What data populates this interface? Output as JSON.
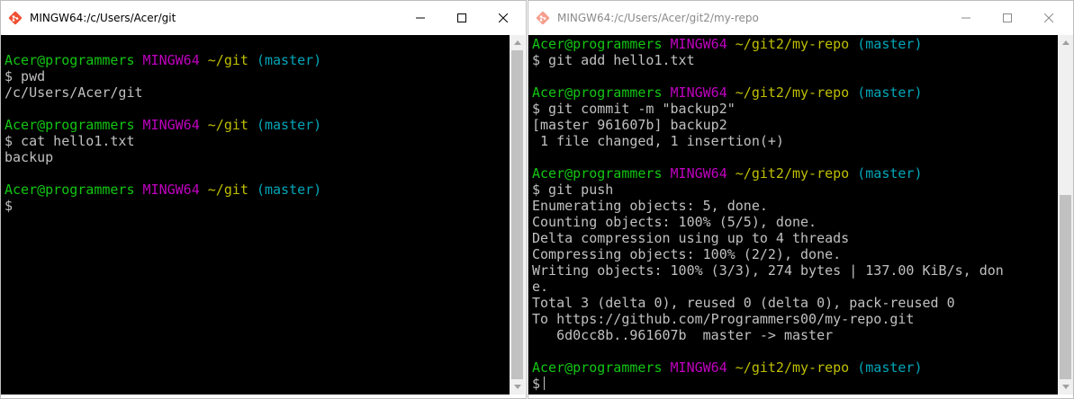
{
  "left_window": {
    "title": "MINGW64:/c/Users/Acer/git",
    "icon": "git-bash-icon",
    "buttons": {
      "minimize": "minimize-icon",
      "maximize": "maximize-icon",
      "close": "close-icon"
    },
    "lines": [
      [
        {
          "t": "Acer@programmers ",
          "c": "green"
        },
        {
          "t": "MINGW64 ",
          "c": "magenta"
        },
        {
          "t": "~/git ",
          "c": "yellow"
        },
        {
          "t": "(master)",
          "c": "cyan"
        }
      ],
      [
        {
          "t": "$ pwd",
          "c": "white"
        }
      ],
      [
        {
          "t": "/c/Users/Acer/git",
          "c": "white"
        }
      ],
      [],
      [
        {
          "t": "Acer@programmers ",
          "c": "green"
        },
        {
          "t": "MINGW64 ",
          "c": "magenta"
        },
        {
          "t": "~/git ",
          "c": "yellow"
        },
        {
          "t": "(master)",
          "c": "cyan"
        }
      ],
      [
        {
          "t": "$ cat hello1.txt",
          "c": "white"
        }
      ],
      [
        {
          "t": "backup",
          "c": "white"
        }
      ],
      [],
      [
        {
          "t": "Acer@programmers ",
          "c": "green"
        },
        {
          "t": "MINGW64 ",
          "c": "magenta"
        },
        {
          "t": "~/git ",
          "c": "yellow"
        },
        {
          "t": "(master)",
          "c": "cyan"
        }
      ],
      [
        {
          "t": "$",
          "c": "white"
        }
      ]
    ]
  },
  "right_window": {
    "title": "MINGW64:/c/Users/Acer/git2/my-repo",
    "icon": "git-bash-icon",
    "buttons": {
      "minimize": "minimize-icon",
      "maximize": "maximize-icon",
      "close": "close-icon"
    },
    "lines": [
      [
        {
          "t": "Acer@programmers ",
          "c": "green"
        },
        {
          "t": "MINGW64 ",
          "c": "magenta"
        },
        {
          "t": "~/git2/my-repo ",
          "c": "yellow"
        },
        {
          "t": "(master)",
          "c": "cyan"
        }
      ],
      [
        {
          "t": "$ git add hello1.txt",
          "c": "white"
        }
      ],
      [],
      [
        {
          "t": "Acer@programmers ",
          "c": "green"
        },
        {
          "t": "MINGW64 ",
          "c": "magenta"
        },
        {
          "t": "~/git2/my-repo ",
          "c": "yellow"
        },
        {
          "t": "(master)",
          "c": "cyan"
        }
      ],
      [
        {
          "t": "$ git commit -m \"backup2\"",
          "c": "white"
        }
      ],
      [
        {
          "t": "[master 961607b] backup2",
          "c": "white"
        }
      ],
      [
        {
          "t": " 1 file changed, 1 insertion(+)",
          "c": "white"
        }
      ],
      [],
      [
        {
          "t": "Acer@programmers ",
          "c": "green"
        },
        {
          "t": "MINGW64 ",
          "c": "magenta"
        },
        {
          "t": "~/git2/my-repo ",
          "c": "yellow"
        },
        {
          "t": "(master)",
          "c": "cyan"
        }
      ],
      [
        {
          "t": "$ git push",
          "c": "white"
        }
      ],
      [
        {
          "t": "Enumerating objects: 5, done.",
          "c": "white"
        }
      ],
      [
        {
          "t": "Counting objects: 100% (5/5), done.",
          "c": "white"
        }
      ],
      [
        {
          "t": "Delta compression using up to 4 threads",
          "c": "white"
        }
      ],
      [
        {
          "t": "Compressing objects: 100% (2/2), done.",
          "c": "white"
        }
      ],
      [
        {
          "t": "Writing objects: 100% (3/3), 274 bytes | 137.00 KiB/s, don",
          "c": "white"
        }
      ],
      [
        {
          "t": "e.",
          "c": "white"
        }
      ],
      [
        {
          "t": "Total 3 (delta 0), reused 0 (delta 0), pack-reused 0",
          "c": "white"
        }
      ],
      [
        {
          "t": "To https://github.com/Programmers00/my-repo.git",
          "c": "white"
        }
      ],
      [
        {
          "t": "   6d0cc8b..961607b  master -> master",
          "c": "white"
        }
      ],
      [],
      [
        {
          "t": "Acer@programmers ",
          "c": "green"
        },
        {
          "t": "MINGW64 ",
          "c": "magenta"
        },
        {
          "t": "~/git2/my-repo ",
          "c": "yellow"
        },
        {
          "t": "(master)",
          "c": "cyan"
        }
      ],
      [
        {
          "t": "$",
          "c": "white"
        }
      ]
    ]
  },
  "colors": {
    "green": "#13c613",
    "magenta": "#bf00bf",
    "yellow": "#bfbf00",
    "cyan": "#00a6b8",
    "white": "#c0c0c0",
    "terminal_background": "#000000"
  }
}
